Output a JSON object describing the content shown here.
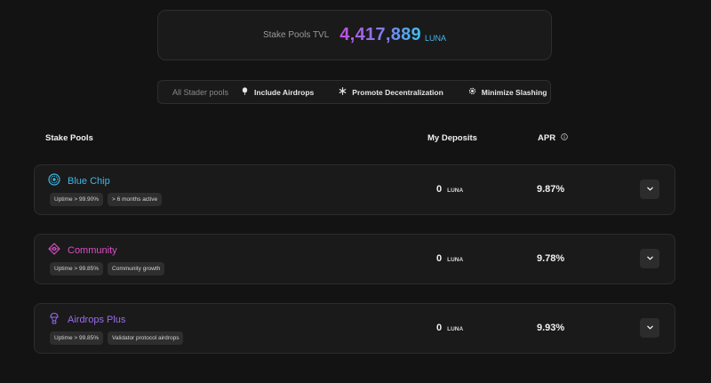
{
  "tvl": {
    "label": "Stake Pools TVL",
    "value": "4,417,889",
    "unit": "LUNA"
  },
  "filters": {
    "label": "All Stader pools",
    "items": [
      {
        "label": "Include Airdrops",
        "icon": "balloon-icon"
      },
      {
        "label": "Promote Decentralization",
        "icon": "asterisk-icon"
      },
      {
        "label": "Minimize Slashing",
        "icon": "gear-icon"
      }
    ]
  },
  "table": {
    "headers": {
      "pools": "Stake Pools",
      "deposits": "My Deposits",
      "apr": "APR"
    }
  },
  "pools": [
    {
      "name": "Blue Chip",
      "color": "#3db8e4",
      "icon": "blue-chip-icon",
      "tags": [
        "Uptime > 99.90%",
        "> 6 months active"
      ],
      "deposit": "0",
      "deposit_unit": "LUNA",
      "apr": "9.87%"
    },
    {
      "name": "Community",
      "color": "#d84fc4",
      "icon": "community-icon",
      "tags": [
        "Uptime > 99.85%",
        "Community growth"
      ],
      "deposit": "0",
      "deposit_unit": "LUNA",
      "apr": "9.78%"
    },
    {
      "name": "Airdrops Plus",
      "color": "#9a6cf0",
      "icon": "airdrops-plus-icon",
      "tags": [
        "Uptime > 99.85%",
        "Validator protocol airdrops"
      ],
      "deposit": "0",
      "deposit_unit": "LUNA",
      "apr": "9.93%"
    }
  ]
}
